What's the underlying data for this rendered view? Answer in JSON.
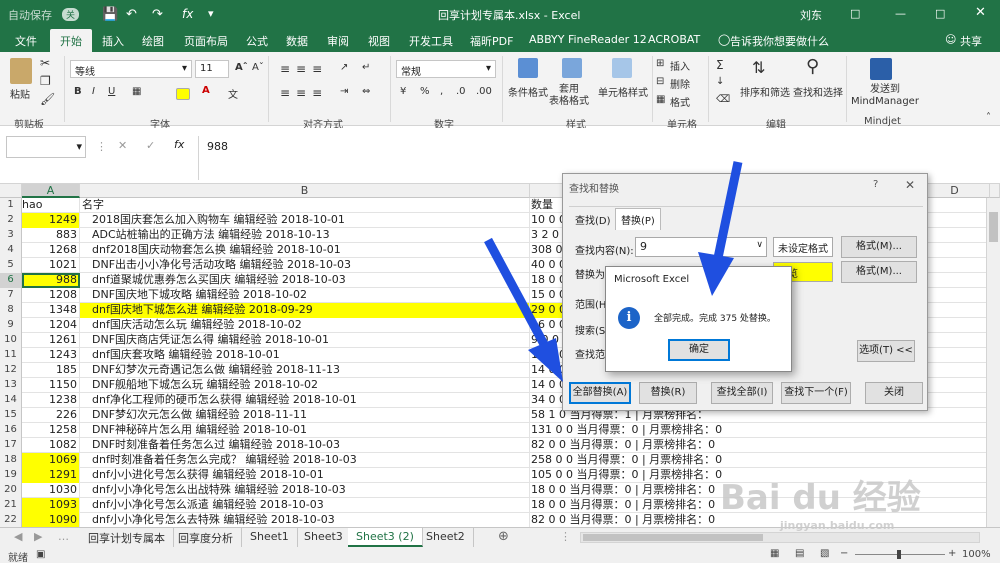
{
  "title_bar": {
    "autosave_label": "自动保存",
    "autosave_state": "关",
    "document_title": "回享计划专属本.xlsx  -  Excel",
    "user": "刘东"
  },
  "menu": {
    "tabs": [
      "文件",
      "开始",
      "插入",
      "绘图",
      "页面布局",
      "公式",
      "数据",
      "审阅",
      "视图",
      "开发工具",
      "福昕PDF",
      "ABBYY FineReader 12",
      "ACROBAT"
    ],
    "active_tab": "开始",
    "tell_me": "告诉我你想要做什么",
    "share": "共享"
  },
  "ribbon": {
    "paste_label": "粘贴",
    "clipboard_group": "剪贴板",
    "font_name": "等线",
    "font_size": "11",
    "font_group": "字体",
    "align_group": "对齐方式",
    "number_format": "常规",
    "number_group": "数字",
    "cond_format": "条件格式",
    "table_format": "套用\n表格格式",
    "cell_style": "单元格样式",
    "style_group": "样式",
    "insert": "插入",
    "delete": "删除",
    "format": "格式",
    "cells_group": "单元格",
    "sort_filter": "排序和筛选",
    "find_select": "查找和选择",
    "edit_group": "编辑",
    "send_to": "发送到\nMindManager",
    "mindjet_group": "Mindjet"
  },
  "formula_bar": {
    "name_box": "",
    "fx": "fx",
    "value": "988"
  },
  "grid": {
    "columns": [
      "A",
      "B",
      "C",
      "D"
    ],
    "selected_column": "A",
    "selected_row": 6,
    "rows": [
      {
        "n": "1",
        "a": "hao",
        "b": "名字",
        "c": "数量",
        "yel_a": false,
        "yel_b": false,
        "head": true
      },
      {
        "n": "2",
        "a": "1249",
        "b": "2018国庆套怎么加入购物车 编辑经验 2018-10-01",
        "c": "10 0 0",
        "yel_a": true,
        "yel_b": false
      },
      {
        "n": "3",
        "a": "883",
        "b": "ADC站桩输出的正确方法 编辑经验 2018-10-13",
        "c": "3 2 0",
        "yel_a": false,
        "yel_b": false
      },
      {
        "n": "4",
        "a": "1268",
        "b": "dnf2018国庆动物套怎么换 编辑经验 2018-10-01",
        "c": "308 0",
        "yel_a": false,
        "yel_b": false
      },
      {
        "n": "5",
        "a": "1021",
        "b": "DNF出击小小净化号活动攻略 编辑经验 2018-10-03",
        "c": "40 0 0",
        "yel_a": false,
        "yel_b": false
      },
      {
        "n": "6",
        "a": "988",
        "b": "dnf道聚城优惠券怎么买国庆 编辑经验 2018-10-03",
        "c": "18 0 0",
        "yel_a": true,
        "yel_b": false
      },
      {
        "n": "7",
        "a": "1208",
        "b": "DNF国庆地下城攻略 编辑经验 2018-10-02",
        "c": "15 0 0",
        "yel_a": false,
        "yel_b": false
      },
      {
        "n": "8",
        "a": "1348",
        "b": "dnf国庆地下城怎么进 编辑经验 2018-09-29",
        "c": "29 0 0",
        "yel_a": false,
        "yel_b": true
      },
      {
        "n": "9",
        "a": "1204",
        "b": "dnf国庆活动怎么玩 编辑经验 2018-10-02",
        "c": "16 0 0",
        "yel_a": false,
        "yel_b": false
      },
      {
        "n": "10",
        "a": "1261",
        "b": "DNF国庆商店凭证怎么得 编辑经验 2018-10-01",
        "c": "9 0 0",
        "yel_a": false,
        "yel_b": false
      },
      {
        "n": "11",
        "a": "1243",
        "b": "dnf国庆套攻略 编辑经验 2018-10-01",
        "c": "12 0 0",
        "yel_a": false,
        "yel_b": false
      },
      {
        "n": "12",
        "a": "185",
        "b": "DNF幻梦次元奇遇记怎么做 编辑经验 2018-11-13",
        "c": "14 0 0",
        "yel_a": false,
        "yel_b": false
      },
      {
        "n": "13",
        "a": "1150",
        "b": "DNF舰船地下城怎么玩 编辑经验 2018-10-02",
        "c": "14 0 0",
        "yel_a": false,
        "yel_b": false
      },
      {
        "n": "14",
        "a": "1238",
        "b": "dnf净化工程师的硬币怎么获得 编辑经验 2018-10-01",
        "c": "34 0 0",
        "yel_a": false,
        "yel_b": false
      },
      {
        "n": "15",
        "a": "226",
        "b": "DNF梦幻次元怎么做 编辑经验 2018-11-11",
        "c": "58 1 0 当月得票：1 | 月票榜排名：",
        "yel_a": false,
        "yel_b": false
      },
      {
        "n": "16",
        "a": "1258",
        "b": "DNF神秘碎片怎么用 编辑经验 2018-10-01",
        "c": "131 0 0 当月得票：0 | 月票榜排名：0",
        "yel_a": false,
        "yel_b": false
      },
      {
        "n": "17",
        "a": "1082",
        "b": "DNF时刻准备着任务怎么过 编辑经验 2018-10-03",
        "c": "82 0 0 当月得票：0 | 月票榜排名：0",
        "yel_a": false,
        "yel_b": false
      },
      {
        "n": "18",
        "a": "1069",
        "b": "dnf时刻准备着任务怎么完成？ 编辑经验 2018-10-03",
        "c": "258 0 0 当月得票：0 | 月票榜排名：0",
        "yel_a": true,
        "yel_b": false
      },
      {
        "n": "19",
        "a": "1291",
        "b": "dnf小小进化号怎么获得 编辑经验 2018-10-01",
        "c": "105 0 0 当月得票：0 | 月票榜排名：0",
        "yel_a": true,
        "yel_b": false
      },
      {
        "n": "20",
        "a": "1030",
        "b": "dnf小小净化号怎么出战特殊 编辑经验 2018-10-03",
        "c": "18 0 0 当月得票：0 | 月票榜排名：0",
        "yel_a": false,
        "yel_b": false
      },
      {
        "n": "21",
        "a": "1093",
        "b": "dnf小小净化号怎么派遣 编辑经验 2018-10-03",
        "c": "18 0 0 当月得票：0 | 月票榜排名：0",
        "yel_a": true,
        "yel_b": false
      },
      {
        "n": "22",
        "a": "1090",
        "b": "dnf小小净化号怎么去特殊 编辑经验 2018-10-03",
        "c": "82 0 0 当月得票：0 | 月票榜排名：0",
        "yel_a": true,
        "yel_b": false
      }
    ]
  },
  "sheets": {
    "tabs": [
      "回享计划专属本",
      "回享度分析",
      "Sheet1",
      "Sheet3",
      "Sheet3 (2)",
      "Sheet2"
    ],
    "active": "Sheet3 (2)"
  },
  "status": {
    "ready": "就绪",
    "zoom": "100%"
  },
  "find_dialog": {
    "title": "查找和替换",
    "help": "?",
    "tab_find": "查找(D)",
    "tab_replace": "替换(P)",
    "find_label": "查找内容(N):",
    "find_value": "9",
    "find_format_status": "未设定格式",
    "format_btn": "格式(M)...",
    "replace_label": "替换为",
    "replace_preview": "预览",
    "format_btn2": "格式(M)...",
    "scope_label": "范围(H",
    "search_label": "搜索(S",
    "lookin_label": "查找范",
    "options_btn": "选项(T) <<",
    "replace_all": "全部替换(A)",
    "replace": "替换(R)",
    "find_all": "查找全部(I)",
    "find_next": "查找下一个(F)",
    "close": "关闭"
  },
  "message_box": {
    "title": "Microsoft Excel",
    "text": "全部完成。完成 375 处替换。",
    "ok": "确定"
  },
  "watermark": {
    "text": "Bai du 经验",
    "url": "jingyan.baidu.com"
  },
  "colors": {
    "excel_green": "#217346",
    "highlight": "#ffff00",
    "arrow_blue": "#1f4fe0"
  }
}
